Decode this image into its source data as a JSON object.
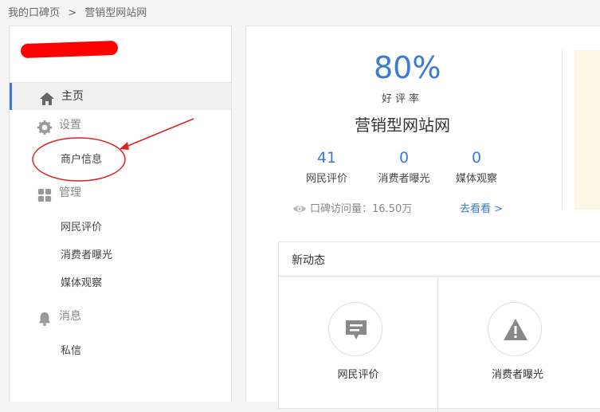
{
  "breadcrumb": {
    "home": "我的口碑页",
    "separator": ">",
    "current": "营销型网站网"
  },
  "sidebar": {
    "items": [
      {
        "label": "主页",
        "icon": "home-icon"
      },
      {
        "label": "设置",
        "icon": "gear-icon"
      },
      {
        "label": "商户信息"
      },
      {
        "label": "管理",
        "icon": "grid-icon"
      },
      {
        "label": "网民评价"
      },
      {
        "label": "消费者曝光"
      },
      {
        "label": "媒体观察"
      },
      {
        "label": "消息",
        "icon": "bell-icon"
      },
      {
        "label": "私信"
      }
    ]
  },
  "summary": {
    "rate": "80%",
    "rate_label": "好评率",
    "site_name": "营销型网站网",
    "stats": [
      {
        "value": "41",
        "label": "网民评价"
      },
      {
        "value": "0",
        "label": "消费者曝光"
      },
      {
        "value": "0",
        "label": "媒体观察"
      }
    ],
    "visits": "口碑访问量：16.50万",
    "go_link": "去看看 >"
  },
  "news": {
    "title": "新动态",
    "cards": [
      {
        "label": "网民评价",
        "icon": "comment-icon"
      },
      {
        "label": "消费者曝光",
        "icon": "warning-icon"
      }
    ]
  },
  "colors": {
    "accent": "#3a7bd5",
    "annotation": "#e02020"
  }
}
